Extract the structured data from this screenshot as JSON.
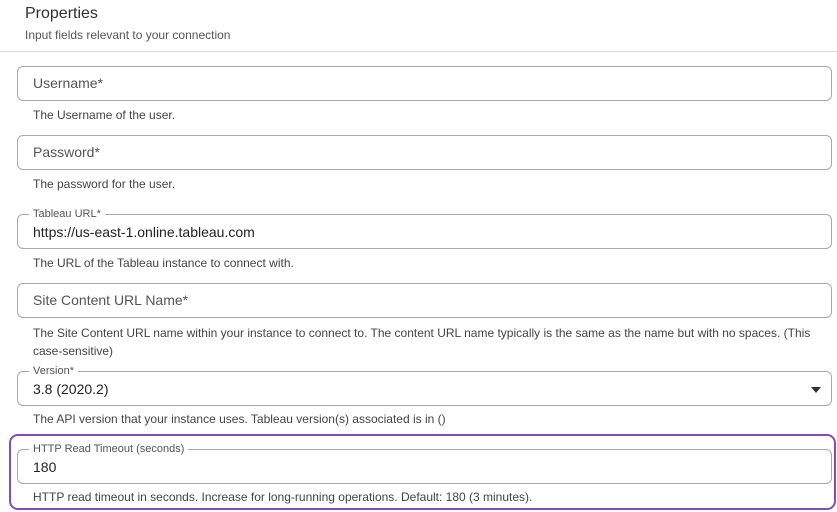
{
  "header": {
    "title": "Properties",
    "subtitle": "Input fields relevant to your connection"
  },
  "fields": {
    "username": {
      "placeholder": "Username*",
      "help": "The Username of the user."
    },
    "password": {
      "placeholder": "Password*",
      "help": "The password for the user."
    },
    "tableau_url": {
      "label": "Tableau URL*",
      "value": "https://us-east-1.online.tableau.com",
      "help": "The URL of the Tableau instance to connect with."
    },
    "site_content_url": {
      "placeholder": "Site Content URL Name*",
      "help": "The Site Content URL name within your instance to connect to. The content URL name typically is the same as the name but with no spaces. (This case-sensitive)"
    },
    "version": {
      "label": "Version*",
      "selected": "3.8 (2020.2)",
      "help": "The API version that your instance uses. Tableau version(s) associated is in ()"
    },
    "http_read_timeout": {
      "label": "HTTP Read Timeout (seconds)",
      "value": "180",
      "help": "HTTP read timeout in seconds. Increase for long-running operations. Default: 180 (3 minutes)."
    }
  },
  "colors": {
    "highlight": "#8a4ab5",
    "border": "#a9a9a9"
  }
}
